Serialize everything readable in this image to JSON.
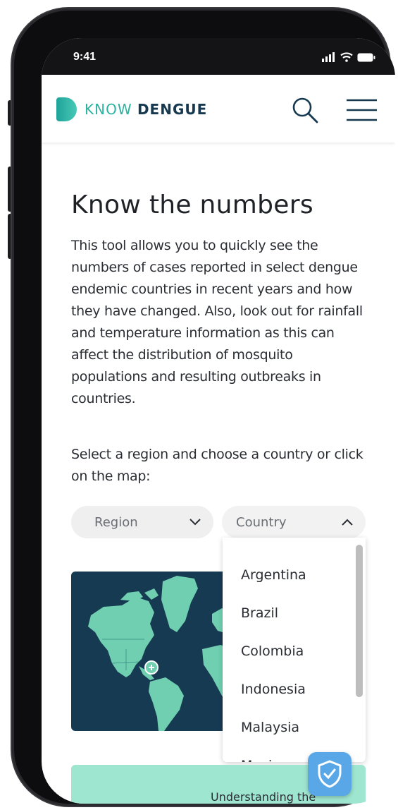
{
  "status_bar": {
    "time": "9:41"
  },
  "header": {
    "logo_know": "KNOW",
    "logo_dengue": "DENGUE"
  },
  "main": {
    "title": "Know the numbers",
    "intro": "This tool allows you to quickly see the numbers of cases reported in select dengue endemic countries in recent years and how they have changed. Also, look out for rainfall and temperature information as this can affect the distribution of mosquito populations and resulting outbreaks in countries.",
    "select_prompt": "Select a region and choose a country or click on the map:",
    "region_dropdown": {
      "label": "Region"
    },
    "country_dropdown": {
      "label": "Country",
      "expanded": true,
      "options": [
        "Argentina",
        "Brazil",
        "Colombia",
        "Indonesia",
        "Malaysia",
        "Mexico"
      ]
    },
    "banner_text": "Understanding the"
  },
  "colors": {
    "brand_teal": "#2bb3a0",
    "brand_navy": "#16394f",
    "map_ocean": "#173a53",
    "map_land": "#6fcfb0",
    "banner_bg": "#9ee6d0",
    "shield_bg": "#5aa7e8"
  }
}
